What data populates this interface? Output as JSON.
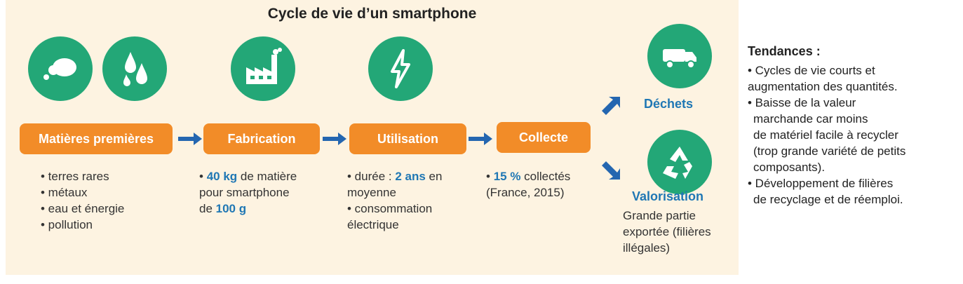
{
  "title": "Cycle de vie d’un smartphone",
  "stages": [
    {
      "label": "Matières premières",
      "items": [
        "• terres rares",
        "• métaux",
        "• eau et énergie",
        "• pollution"
      ]
    },
    {
      "label": "Fabrication"
    },
    {
      "label": "Utilisation"
    },
    {
      "label": "Collecte"
    }
  ],
  "fabrication": {
    "line1_pre": "• ",
    "line1_hl": "40 kg",
    "line1_post": " de matière",
    "line2": "pour smartphone",
    "line3_pre": "de ",
    "line3_hl": "100 g"
  },
  "utilisation": {
    "line1_pre": "• durée : ",
    "line1_hl": "2 ans",
    "line1_post": " en",
    "line2": "moyenne",
    "line3": "• consommation",
    "line4": "électrique"
  },
  "collecte": {
    "line1_pre": "• ",
    "line1_hl": "15 %",
    "line1_post": " collectés",
    "line2": "(France, 2015)"
  },
  "outcomes": {
    "dechets": "Déchets",
    "valorisation": "Valorisation",
    "valorisation_desc": [
      "Grande partie",
      "exportée (filières",
      "illégales)"
    ]
  },
  "trends": {
    "title": "Tendances :",
    "items": [
      "• Cycles de vie courts et",
      "augmentation des quantités.",
      "• Baisse de la valeur",
      "  marchande car moins",
      "  de matériel facile à recycler",
      "  (trop grande variété de petits",
      "  composants).",
      "• Développement de filières",
      "  de recyclage et de réemploi."
    ]
  },
  "icons": [
    "clouds-icon",
    "water-drops-icon",
    "factory-icon",
    "lightning-icon",
    "truck-icon",
    "recycle-icon"
  ],
  "colors": {
    "stage": "#f28c28",
    "circle": "#23a777",
    "highlight": "#1f77b4",
    "arrow": "#2466b0",
    "panel": "#fdf3e1"
  }
}
